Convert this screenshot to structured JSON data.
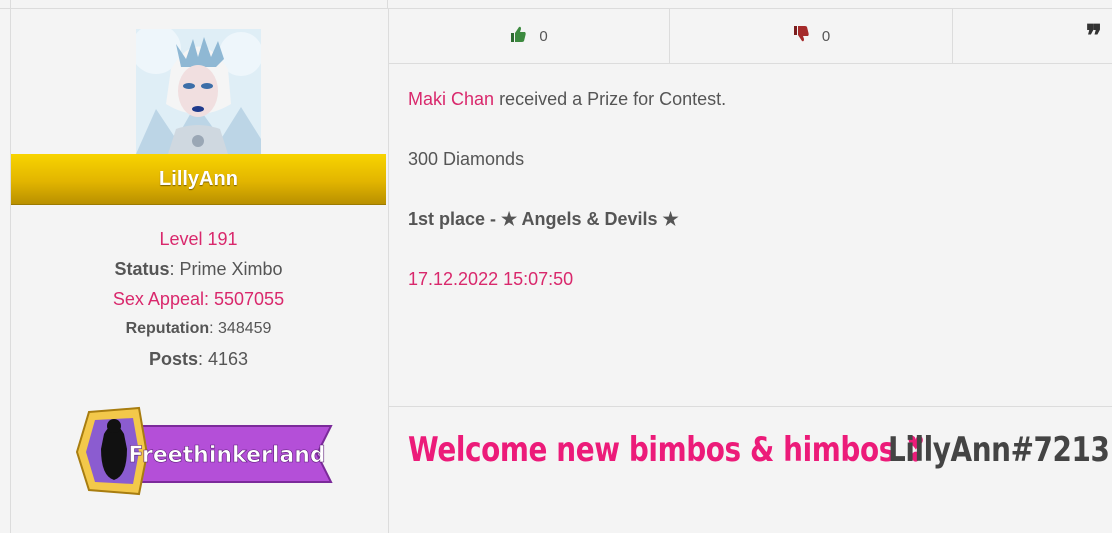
{
  "user": {
    "name": "LillyAnn",
    "level_label": "Level 191",
    "status_label": "Status",
    "status_value": "Prime Ximbo",
    "sex_appeal_label": "Sex Appeal",
    "sex_appeal_value": "5507055",
    "reputation_label": "Reputation",
    "reputation_value": "348459",
    "posts_label": "Posts",
    "posts_value": "4163",
    "badge_text": "Freethinkerland"
  },
  "reactions": {
    "likes": "0",
    "dislikes": "0"
  },
  "post": {
    "actor": "Maki Chan",
    "action_text": "received a Prize for Contest.",
    "prize": "300 Diamonds",
    "place": "1st place - ★ Angels & Devils ★",
    "date": "17.12.2022 15:07:50"
  },
  "signature": {
    "welcome": "Welcome new bimbos & himbos ❣",
    "tag": "LillyAnn#7213"
  },
  "colors": {
    "accent_pink": "#d9286c",
    "gold": "#f2c600",
    "badge_purple": "#b44fd8"
  }
}
